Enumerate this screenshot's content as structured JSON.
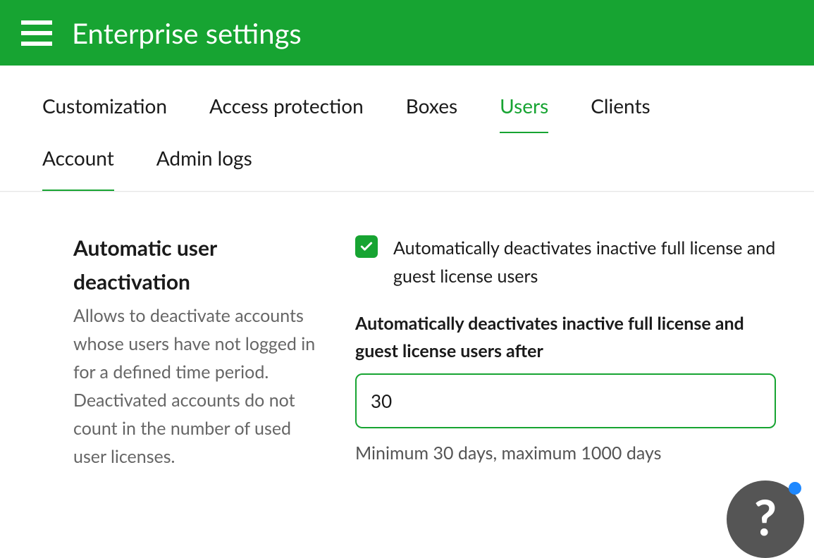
{
  "header": {
    "title": "Enterprise settings"
  },
  "tabs": {
    "row1": [
      {
        "label": "Customization",
        "active": false
      },
      {
        "label": "Access protection",
        "active": false
      },
      {
        "label": "Boxes",
        "active": false
      },
      {
        "label": "Users",
        "active": true
      },
      {
        "label": "Clients",
        "active": false
      }
    ],
    "row2": [
      {
        "label": "Account",
        "underlined": true
      },
      {
        "label": "Admin logs",
        "underlined": false
      }
    ]
  },
  "section": {
    "title": "Automatic user deactivation",
    "description": "Allows to deactivate accounts whose users have not logged in for a defined time period. Deactivated accounts do not count in the number of used user licenses."
  },
  "form": {
    "checkbox_label": "Automatically deactivates inactive full license and guest license users",
    "checkbox_checked": true,
    "field_label": "Automatically deactivates inactive full license and guest license users after",
    "field_value": "30",
    "field_hint": "Minimum 30 days, maximum 1000 days"
  },
  "help": {
    "label": "?"
  }
}
